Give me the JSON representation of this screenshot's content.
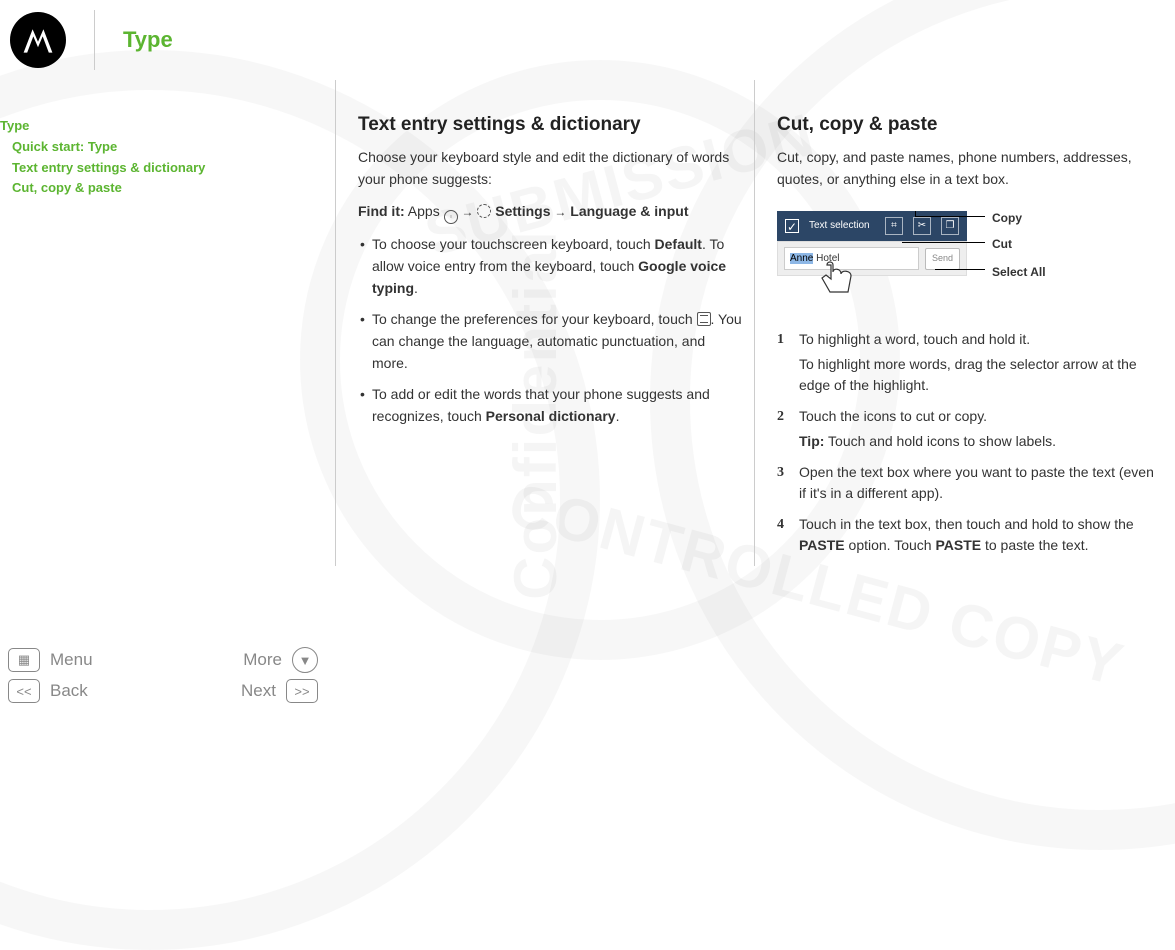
{
  "header": {
    "title": "Type"
  },
  "watermark": {
    "t1": "SUBMISSION",
    "t2": "Confidential",
    "t3": "CONTROLLED COPY"
  },
  "toc": {
    "root": "Type",
    "items": [
      "Quick start: Type",
      "Text entry settings & dictionary",
      "Cut, copy & paste"
    ]
  },
  "left": {
    "h": "Text entry settings & dictionary",
    "intro": "Choose your keyboard style and edit the dictionary of words your phone suggests:",
    "findit_label": "Find it:",
    "apps": "Apps",
    "settings": "Settings",
    "lang": "Language & input",
    "b1a": "To choose your touchscreen keyboard, touch ",
    "b1b": "Default",
    "b1c": ". To allow voice entry from the keyboard, touch ",
    "b1d": "Google voice typing",
    "b1e": ".",
    "b2a": "To change the preferences for your keyboard, touch ",
    "b2b": ". You can change the language, automatic punctuation, and more.",
    "b3a": "To add or edit the words that your phone suggests and recognizes, touch ",
    "b3b": "Personal dictionary",
    "b3c": "."
  },
  "right": {
    "h": "Cut, copy & paste",
    "intro": "Cut, copy, and paste names, phone numbers, addresses, quotes, or anything else in a text box.",
    "diagram": {
      "bar_label": "Text selection",
      "field_sel": "Anne",
      "field_rest": " Hotel",
      "send": "Send",
      "copy": "Copy",
      "cut": "Cut",
      "selectall": "Select All"
    },
    "s1a": "To highlight a word, touch and hold it.",
    "s1b": "To highlight more words, drag the selector arrow at the edge of the highlight.",
    "s2a": "Touch the icons to cut or copy.",
    "s2tip_label": "Tip:",
    "s2tip": " Touch and hold icons to show labels.",
    "s3": "Open the text box where you want to paste the text (even if it's in a different app).",
    "s4a": "Touch in the text box, then touch and hold to show the ",
    "s4b": "PASTE",
    "s4c": " option. Touch ",
    "s4d": "PASTE",
    "s4e": " to paste the text."
  },
  "footer": {
    "menu": "Menu",
    "more": "More",
    "back": "Back",
    "next": "Next"
  }
}
